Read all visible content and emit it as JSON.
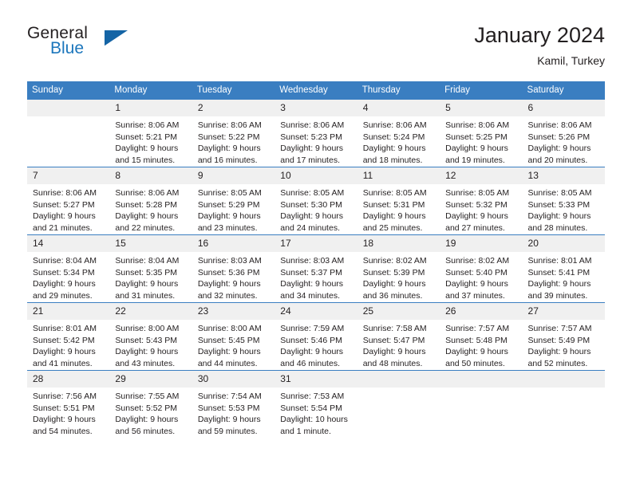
{
  "brand": {
    "name_part1": "General",
    "name_part2": "Blue",
    "flag_color": "#1464a5",
    "accent_color": "#1b76bc"
  },
  "header": {
    "title": "January 2024",
    "subtitle": "Kamil, Turkey"
  },
  "theme": {
    "header_row_bg": "#3a7ec1",
    "daynum_bg": "#f0f0f0",
    "grid_line": "#3a7ec1",
    "text": "#231f20"
  },
  "weekdays": [
    "Sunday",
    "Monday",
    "Tuesday",
    "Wednesday",
    "Thursday",
    "Friday",
    "Saturday"
  ],
  "labels": {
    "sunrise_prefix": "Sunrise:",
    "sunset_prefix": "Sunset:",
    "daylight_prefix": "Daylight:"
  },
  "weeks": [
    [
      {
        "day": "",
        "blank": true,
        "sunrise": "",
        "sunset": "",
        "daylight_line1": "",
        "daylight_line2": ""
      },
      {
        "day": "1",
        "sunrise": "Sunrise: 8:06 AM",
        "sunset": "Sunset: 5:21 PM",
        "daylight_line1": "Daylight: 9 hours",
        "daylight_line2": "and 15 minutes."
      },
      {
        "day": "2",
        "sunrise": "Sunrise: 8:06 AM",
        "sunset": "Sunset: 5:22 PM",
        "daylight_line1": "Daylight: 9 hours",
        "daylight_line2": "and 16 minutes."
      },
      {
        "day": "3",
        "sunrise": "Sunrise: 8:06 AM",
        "sunset": "Sunset: 5:23 PM",
        "daylight_line1": "Daylight: 9 hours",
        "daylight_line2": "and 17 minutes."
      },
      {
        "day": "4",
        "sunrise": "Sunrise: 8:06 AM",
        "sunset": "Sunset: 5:24 PM",
        "daylight_line1": "Daylight: 9 hours",
        "daylight_line2": "and 18 minutes."
      },
      {
        "day": "5",
        "sunrise": "Sunrise: 8:06 AM",
        "sunset": "Sunset: 5:25 PM",
        "daylight_line1": "Daylight: 9 hours",
        "daylight_line2": "and 19 minutes."
      },
      {
        "day": "6",
        "sunrise": "Sunrise: 8:06 AM",
        "sunset": "Sunset: 5:26 PM",
        "daylight_line1": "Daylight: 9 hours",
        "daylight_line2": "and 20 minutes."
      }
    ],
    [
      {
        "day": "7",
        "sunrise": "Sunrise: 8:06 AM",
        "sunset": "Sunset: 5:27 PM",
        "daylight_line1": "Daylight: 9 hours",
        "daylight_line2": "and 21 minutes."
      },
      {
        "day": "8",
        "sunrise": "Sunrise: 8:06 AM",
        "sunset": "Sunset: 5:28 PM",
        "daylight_line1": "Daylight: 9 hours",
        "daylight_line2": "and 22 minutes."
      },
      {
        "day": "9",
        "sunrise": "Sunrise: 8:05 AM",
        "sunset": "Sunset: 5:29 PM",
        "daylight_line1": "Daylight: 9 hours",
        "daylight_line2": "and 23 minutes."
      },
      {
        "day": "10",
        "sunrise": "Sunrise: 8:05 AM",
        "sunset": "Sunset: 5:30 PM",
        "daylight_line1": "Daylight: 9 hours",
        "daylight_line2": "and 24 minutes."
      },
      {
        "day": "11",
        "sunrise": "Sunrise: 8:05 AM",
        "sunset": "Sunset: 5:31 PM",
        "daylight_line1": "Daylight: 9 hours",
        "daylight_line2": "and 25 minutes."
      },
      {
        "day": "12",
        "sunrise": "Sunrise: 8:05 AM",
        "sunset": "Sunset: 5:32 PM",
        "daylight_line1": "Daylight: 9 hours",
        "daylight_line2": "and 27 minutes."
      },
      {
        "day": "13",
        "sunrise": "Sunrise: 8:05 AM",
        "sunset": "Sunset: 5:33 PM",
        "daylight_line1": "Daylight: 9 hours",
        "daylight_line2": "and 28 minutes."
      }
    ],
    [
      {
        "day": "14",
        "sunrise": "Sunrise: 8:04 AM",
        "sunset": "Sunset: 5:34 PM",
        "daylight_line1": "Daylight: 9 hours",
        "daylight_line2": "and 29 minutes."
      },
      {
        "day": "15",
        "sunrise": "Sunrise: 8:04 AM",
        "sunset": "Sunset: 5:35 PM",
        "daylight_line1": "Daylight: 9 hours",
        "daylight_line2": "and 31 minutes."
      },
      {
        "day": "16",
        "sunrise": "Sunrise: 8:03 AM",
        "sunset": "Sunset: 5:36 PM",
        "daylight_line1": "Daylight: 9 hours",
        "daylight_line2": "and 32 minutes."
      },
      {
        "day": "17",
        "sunrise": "Sunrise: 8:03 AM",
        "sunset": "Sunset: 5:37 PM",
        "daylight_line1": "Daylight: 9 hours",
        "daylight_line2": "and 34 minutes."
      },
      {
        "day": "18",
        "sunrise": "Sunrise: 8:02 AM",
        "sunset": "Sunset: 5:39 PM",
        "daylight_line1": "Daylight: 9 hours",
        "daylight_line2": "and 36 minutes."
      },
      {
        "day": "19",
        "sunrise": "Sunrise: 8:02 AM",
        "sunset": "Sunset: 5:40 PM",
        "daylight_line1": "Daylight: 9 hours",
        "daylight_line2": "and 37 minutes."
      },
      {
        "day": "20",
        "sunrise": "Sunrise: 8:01 AM",
        "sunset": "Sunset: 5:41 PM",
        "daylight_line1": "Daylight: 9 hours",
        "daylight_line2": "and 39 minutes."
      }
    ],
    [
      {
        "day": "21",
        "sunrise": "Sunrise: 8:01 AM",
        "sunset": "Sunset: 5:42 PM",
        "daylight_line1": "Daylight: 9 hours",
        "daylight_line2": "and 41 minutes."
      },
      {
        "day": "22",
        "sunrise": "Sunrise: 8:00 AM",
        "sunset": "Sunset: 5:43 PM",
        "daylight_line1": "Daylight: 9 hours",
        "daylight_line2": "and 43 minutes."
      },
      {
        "day": "23",
        "sunrise": "Sunrise: 8:00 AM",
        "sunset": "Sunset: 5:45 PM",
        "daylight_line1": "Daylight: 9 hours",
        "daylight_line2": "and 44 minutes."
      },
      {
        "day": "24",
        "sunrise": "Sunrise: 7:59 AM",
        "sunset": "Sunset: 5:46 PM",
        "daylight_line1": "Daylight: 9 hours",
        "daylight_line2": "and 46 minutes."
      },
      {
        "day": "25",
        "sunrise": "Sunrise: 7:58 AM",
        "sunset": "Sunset: 5:47 PM",
        "daylight_line1": "Daylight: 9 hours",
        "daylight_line2": "and 48 minutes."
      },
      {
        "day": "26",
        "sunrise": "Sunrise: 7:57 AM",
        "sunset": "Sunset: 5:48 PM",
        "daylight_line1": "Daylight: 9 hours",
        "daylight_line2": "and 50 minutes."
      },
      {
        "day": "27",
        "sunrise": "Sunrise: 7:57 AM",
        "sunset": "Sunset: 5:49 PM",
        "daylight_line1": "Daylight: 9 hours",
        "daylight_line2": "and 52 minutes."
      }
    ],
    [
      {
        "day": "28",
        "sunrise": "Sunrise: 7:56 AM",
        "sunset": "Sunset: 5:51 PM",
        "daylight_line1": "Daylight: 9 hours",
        "daylight_line2": "and 54 minutes."
      },
      {
        "day": "29",
        "sunrise": "Sunrise: 7:55 AM",
        "sunset": "Sunset: 5:52 PM",
        "daylight_line1": "Daylight: 9 hours",
        "daylight_line2": "and 56 minutes."
      },
      {
        "day": "30",
        "sunrise": "Sunrise: 7:54 AM",
        "sunset": "Sunset: 5:53 PM",
        "daylight_line1": "Daylight: 9 hours",
        "daylight_line2": "and 59 minutes."
      },
      {
        "day": "31",
        "sunrise": "Sunrise: 7:53 AM",
        "sunset": "Sunset: 5:54 PM",
        "daylight_line1": "Daylight: 10 hours",
        "daylight_line2": "and 1 minute."
      },
      {
        "day": "",
        "blank": true,
        "sunrise": "",
        "sunset": "",
        "daylight_line1": "",
        "daylight_line2": ""
      },
      {
        "day": "",
        "blank": true,
        "sunrise": "",
        "sunset": "",
        "daylight_line1": "",
        "daylight_line2": ""
      },
      {
        "day": "",
        "blank": true,
        "sunrise": "",
        "sunset": "",
        "daylight_line1": "",
        "daylight_line2": ""
      }
    ]
  ]
}
